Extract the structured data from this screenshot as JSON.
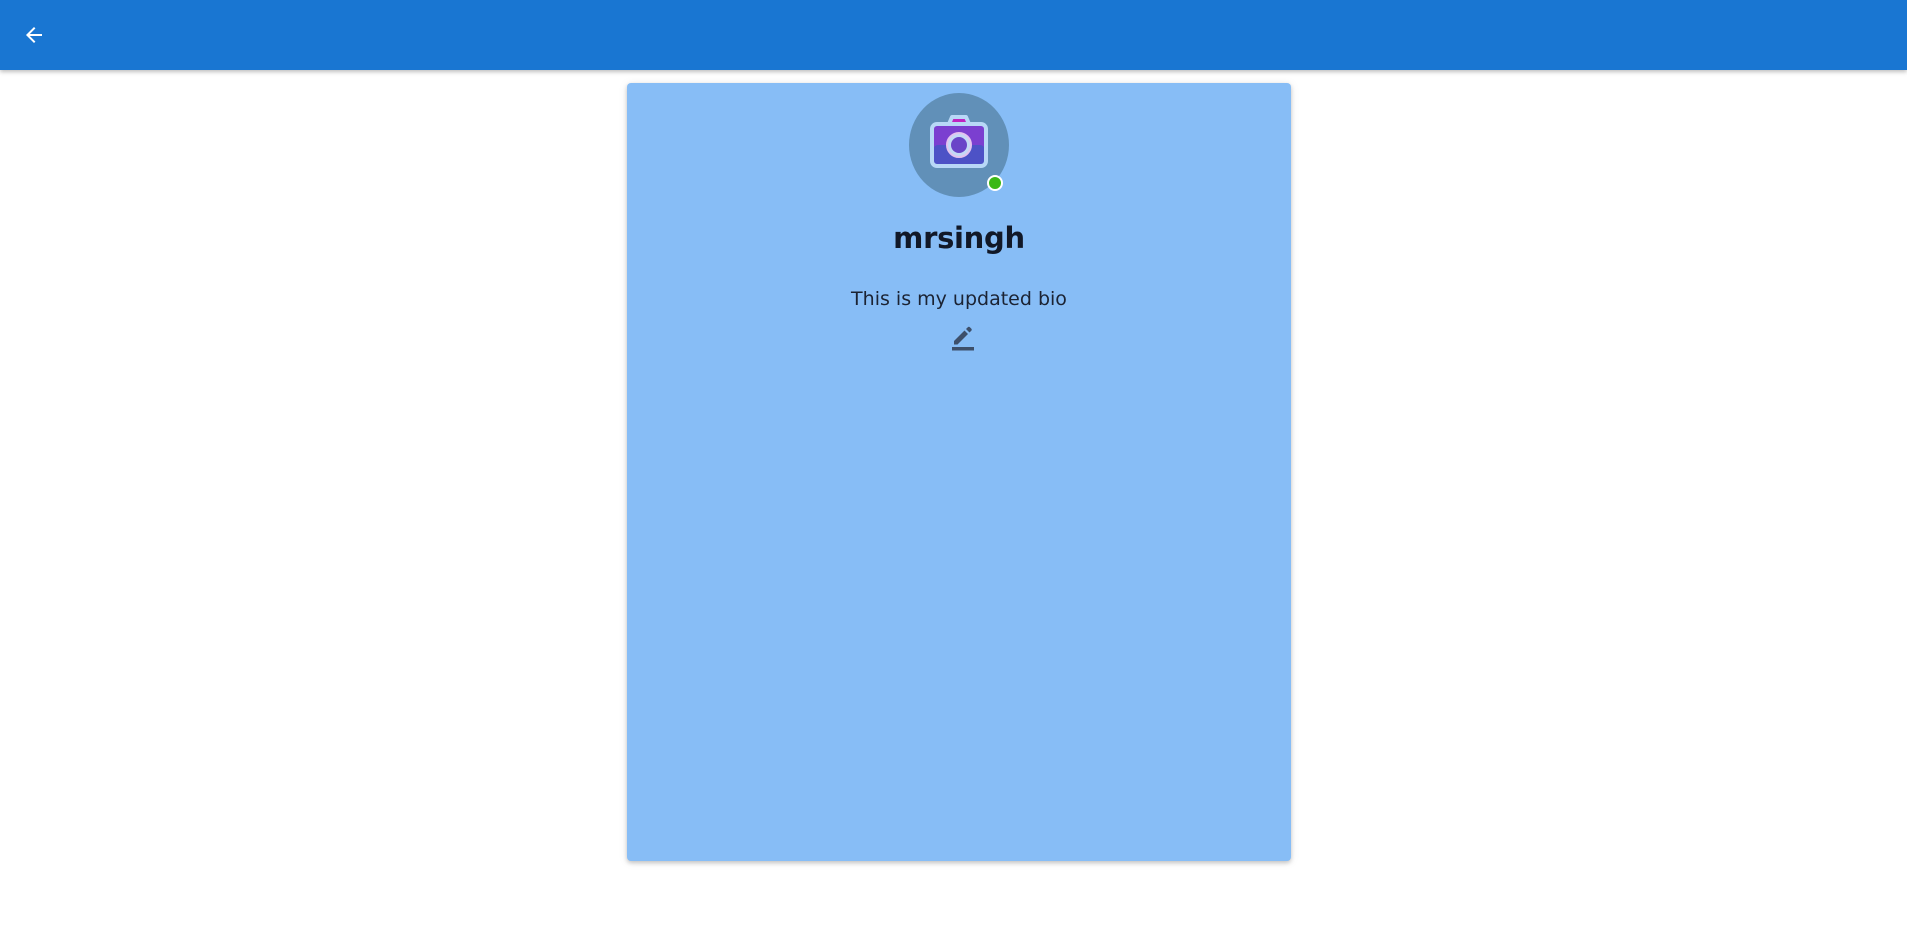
{
  "app_bar": {
    "color": "#1976d2",
    "back_icon": "arrow-left-icon"
  },
  "profile": {
    "username": "mrsingh",
    "bio": "This is my updated bio",
    "avatar_icon": "camera-icon",
    "online_status_color": "#3cb816",
    "card_color": "#87bdf6",
    "edit_icon": "edit-pencil-icon"
  }
}
